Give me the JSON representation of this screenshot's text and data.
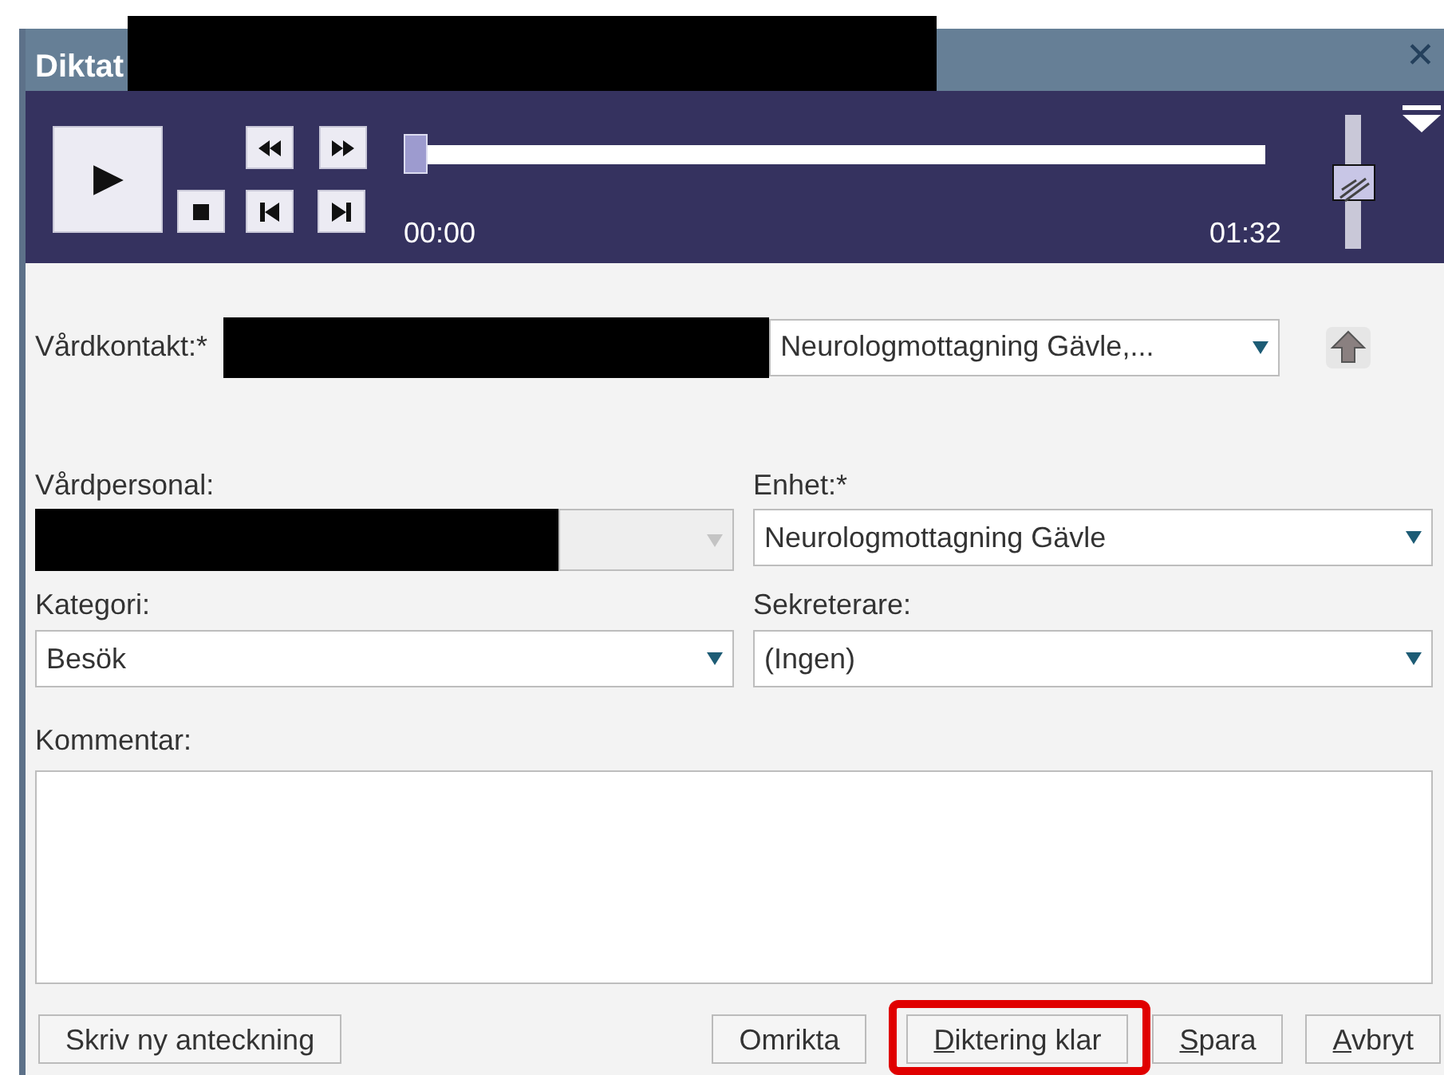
{
  "window": {
    "title": "Diktat",
    "close_glyph": "✕"
  },
  "player": {
    "progress": {
      "level": 0.0
    },
    "elapsed": "00:00",
    "duration": "01:32",
    "volume": {
      "level": 0.5
    }
  },
  "form": {
    "rows": [
      [
        {
          "kind": "inline-select",
          "label": "Vårdkontakt:*",
          "value": "Neurologmottagning Gävle,...",
          "disabled": false,
          "redacted": true
        }
      ],
      [
        {
          "kind": "select",
          "label": "Vårdpersonal:",
          "disabled": true,
          "redacted": true
        },
        {
          "kind": "select",
          "label": "Enhet:*",
          "value": "Neurologmottagning Gävle",
          "disabled": false
        }
      ],
      [
        {
          "kind": "select",
          "label": "Kategori:",
          "value": "Besök",
          "disabled": false
        },
        {
          "kind": "select",
          "label": "Sekreterare:",
          "value": "(Ingen)",
          "disabled": false
        }
      ],
      [
        {
          "kind": "textarea",
          "label": "Kommentar:"
        }
      ]
    ]
  },
  "buttons": [
    {
      "label": "Skriv ny anteckning",
      "mnemonic": false,
      "highlighted": false
    },
    {
      "label": "Omrikta",
      "mnemonic": false,
      "highlighted": false
    },
    {
      "label": "Diktering klar",
      "mnemonic": true,
      "highlighted": true
    },
    {
      "label": "Spara",
      "mnemonic": true,
      "highlighted": false
    },
    {
      "label": "Avbryt",
      "mnemonic": true,
      "highlighted": false
    }
  ]
}
